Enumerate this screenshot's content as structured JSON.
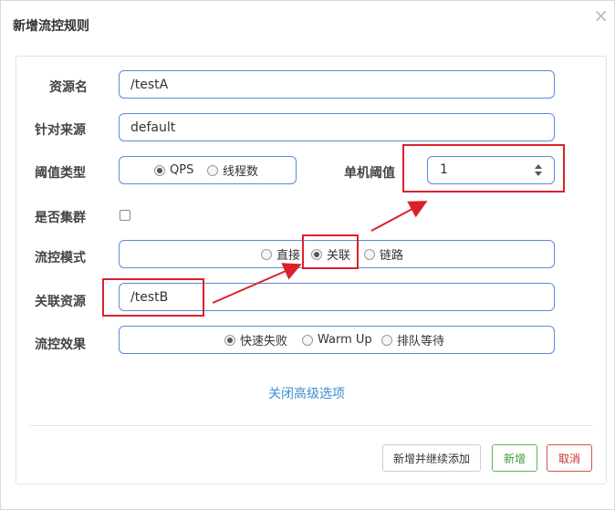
{
  "dialog": {
    "title": "新增流控规则",
    "close_glyph": "×"
  },
  "form": {
    "resource_name": {
      "label": "资源名",
      "value": "/testA"
    },
    "limit_app": {
      "label": "针对来源",
      "value": "default"
    },
    "threshold_type": {
      "label": "阈值类型",
      "options": [
        "QPS",
        "线程数"
      ],
      "selected": "QPS"
    },
    "single_threshold": {
      "label": "单机阈值",
      "value": "1"
    },
    "cluster": {
      "label": "是否集群",
      "checked": false
    },
    "control_mode": {
      "label": "流控模式",
      "options": [
        "直接",
        "关联",
        "链路"
      ],
      "selected": "关联"
    },
    "ref_resource": {
      "label": "关联资源",
      "value": "/testB"
    },
    "control_effect": {
      "label": "流控效果",
      "options": [
        "快速失败",
        "Warm Up",
        "排队等待"
      ],
      "selected": "快速失败"
    }
  },
  "advanced_link": "关闭高级选项",
  "footer": {
    "save_continue": "新增并继续添加",
    "add": "新增",
    "cancel": "取消"
  },
  "colors": {
    "input_border": "#5b8bd6",
    "highlight_box": "#d9222a",
    "link": "#3c8dce",
    "add_button": "#5cb85c",
    "cancel_button": "#d9534f"
  }
}
